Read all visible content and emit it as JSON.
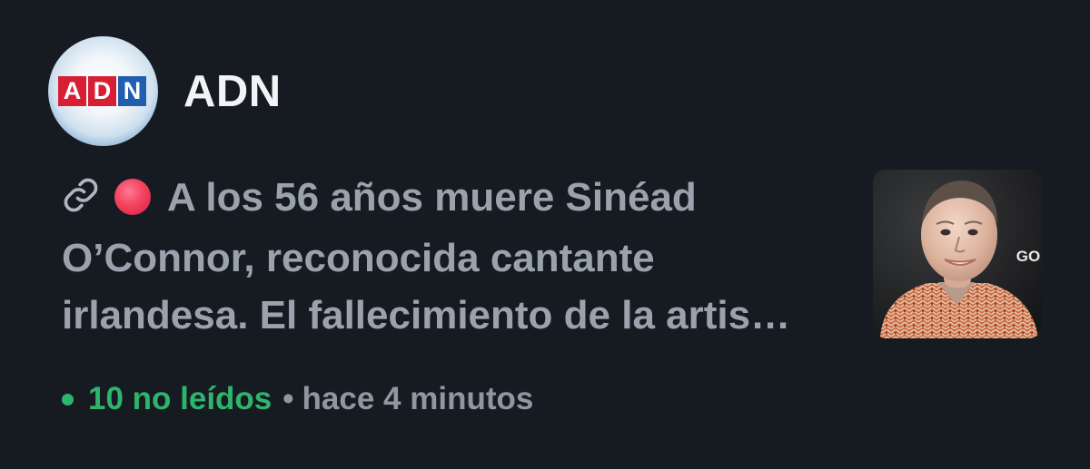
{
  "source": {
    "logo_letters": [
      "A",
      "D",
      "N"
    ],
    "name": "ADN"
  },
  "article": {
    "link_icon": "link-icon",
    "status_icon": "red-circle",
    "headline": "A los 56 años muere Sinéad O’Connor, reconocida cantante irlandesa. El fallecimiento de la artis…",
    "thumbnail_caption": "GO"
  },
  "meta": {
    "unread": "10 no leídos",
    "separator": "•",
    "time": "hace 4 minutos"
  },
  "colors": {
    "background": "#161b22",
    "headline": "#9aa3ad",
    "unread": "#2fb46b",
    "muted": "#8f98a2",
    "logo_red": "#d71f33",
    "logo_blue": "#1f5fae"
  }
}
